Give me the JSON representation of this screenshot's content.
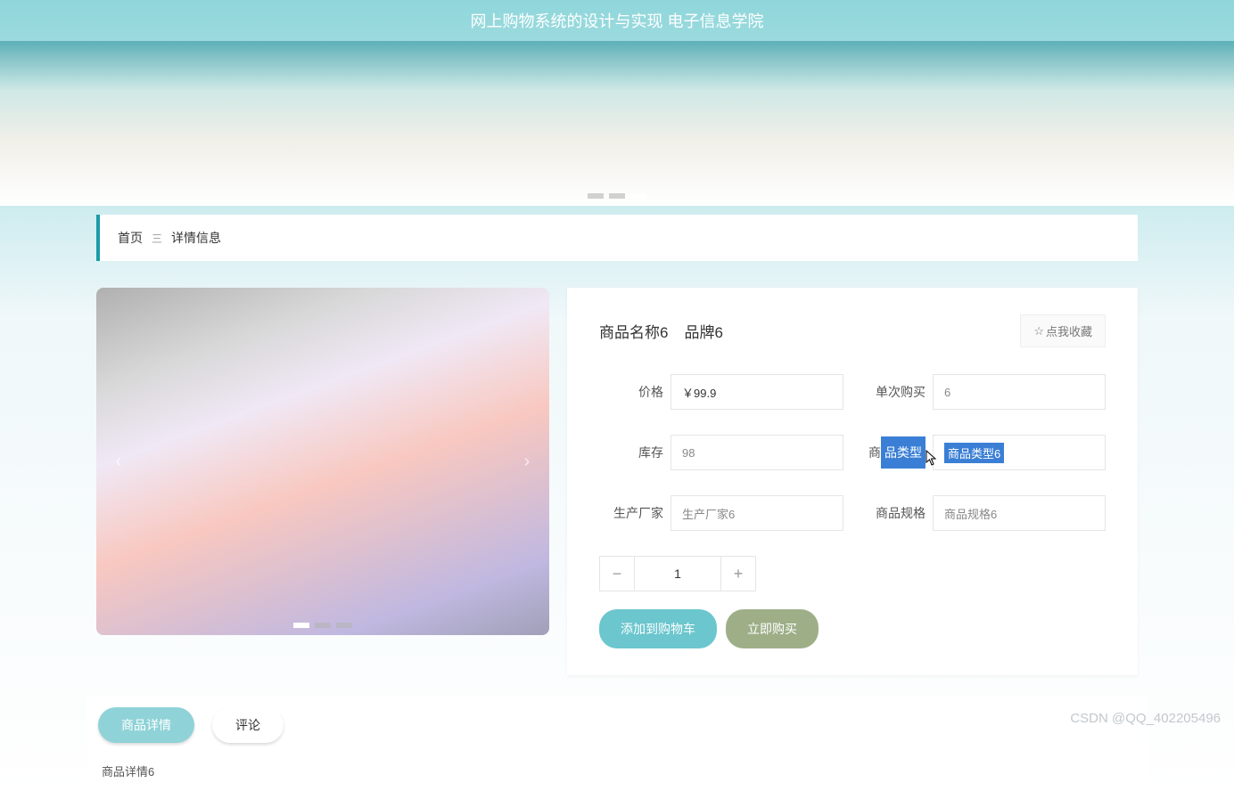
{
  "header": {
    "title": "网上购物系统的设计与实现 电子信息学院"
  },
  "breadcrumb": {
    "home": "首页",
    "sep": "三",
    "current": "详情信息"
  },
  "product": {
    "name": "商品名称6",
    "brand": "品牌6",
    "favorite_label": "点我收藏"
  },
  "fields": {
    "price_label": "价格",
    "price_value": "￥99.9",
    "single_buy_label": "单次购买",
    "single_buy_value": "6",
    "stock_label": "库存",
    "stock_value": "98",
    "type_label": "商品类型",
    "type_value": "商品类型6",
    "maker_label": "生产厂家",
    "maker_value": "生产厂家6",
    "spec_label": "商品规格",
    "spec_value": "商品规格6"
  },
  "quantity": {
    "value": "1"
  },
  "actions": {
    "add_cart": "添加到购物车",
    "buy_now": "立即购买"
  },
  "tabs": {
    "detail": "商品详情",
    "comments": "评论",
    "content": "商品详情6"
  },
  "watermark": "CSDN @QQ_402205496"
}
